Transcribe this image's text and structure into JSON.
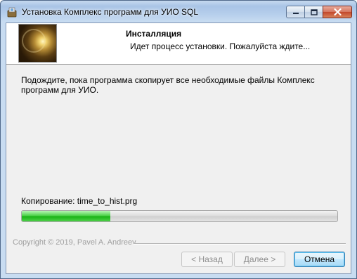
{
  "window": {
    "title": "Установка Комплекс программ для УИО SQL",
    "controls": {
      "minimize": "minimize-icon",
      "maximize": "maximize-icon",
      "close": "close-icon"
    }
  },
  "header": {
    "title": "Инсталляция",
    "subtitle": "Идет процесс установки. Пожалуйста ждите..."
  },
  "body": {
    "message": "Подождите, пока программа скопирует все необходимые файлы Комплекс программ для УИО."
  },
  "progress": {
    "status": "Копирование: time_to_hist.prg",
    "fraction": 0.28
  },
  "footer": {
    "branding": "Copyright © 2019, Pavel A. Andreev"
  },
  "buttons": {
    "back": "< Назад",
    "next": "Далее >",
    "cancel": "Отмена"
  },
  "colors": {
    "progress_fill": "#19b316",
    "title_bar": "#b7cfec",
    "close_button": "#c2472b"
  }
}
